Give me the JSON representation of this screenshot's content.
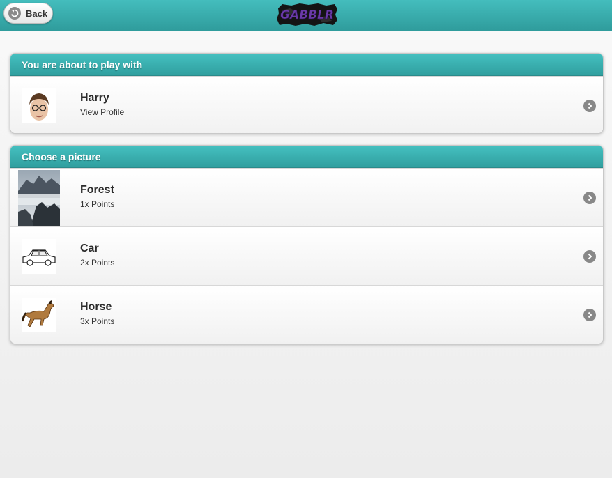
{
  "header": {
    "back_label": "Back",
    "back_icon": "back-arrow-icon",
    "logo_text": "GABBLR"
  },
  "opponent_panel": {
    "title": "You are about to play with",
    "player": {
      "name": "Harry",
      "subtitle": "View Profile",
      "avatar": "harry-face-photo"
    }
  },
  "picture_panel": {
    "title": "Choose a picture",
    "items": [
      {
        "name": "Forest",
        "points": "1x Points",
        "thumb": "misty-mountain-photo"
      },
      {
        "name": "Car",
        "points": "2x Points",
        "thumb": "car-sketch"
      },
      {
        "name": "Horse",
        "points": "3x Points",
        "thumb": "horse-photo"
      }
    ]
  },
  "colors": {
    "accent_top": "#45c0c0",
    "accent_bottom": "#309f9f",
    "logo_text": "#6a3ba8"
  }
}
